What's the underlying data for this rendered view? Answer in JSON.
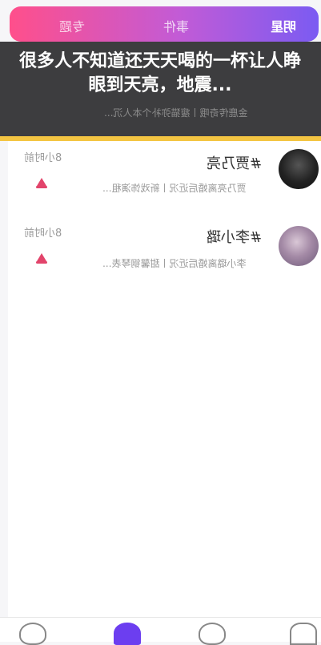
{
  "tabs": [
    "专题",
    "事件",
    "明星"
  ],
  "overlay": {
    "title": "很多人不知道还天天喝的一杯让人睁眼到天亮，地震...",
    "subtitle_mirror": "金鹿传奇哦丨瘦猫弥补个本人沉..."
  },
  "items": [
    {
      "name": "#贾乃亮",
      "time": "8小时前",
      "summary": "贾乃亮离婚后近况丨新戏饰演租..."
    },
    {
      "name": "#李小璐",
      "time": "8小时前",
      "summary": "李小璐离婚后近况丨甜馨钢琴表..."
    }
  ],
  "colors": {
    "accent": "#e2446b",
    "gradient_left": "#ff4f8b",
    "gradient_right": "#7b5bf2",
    "highlight_bar": "#f4c542",
    "nav_active": "#6c3ef0"
  },
  "icons": [
    "bell-icon",
    "smile-icon",
    "home-icon",
    "ghost-icon",
    "house-icon"
  ]
}
